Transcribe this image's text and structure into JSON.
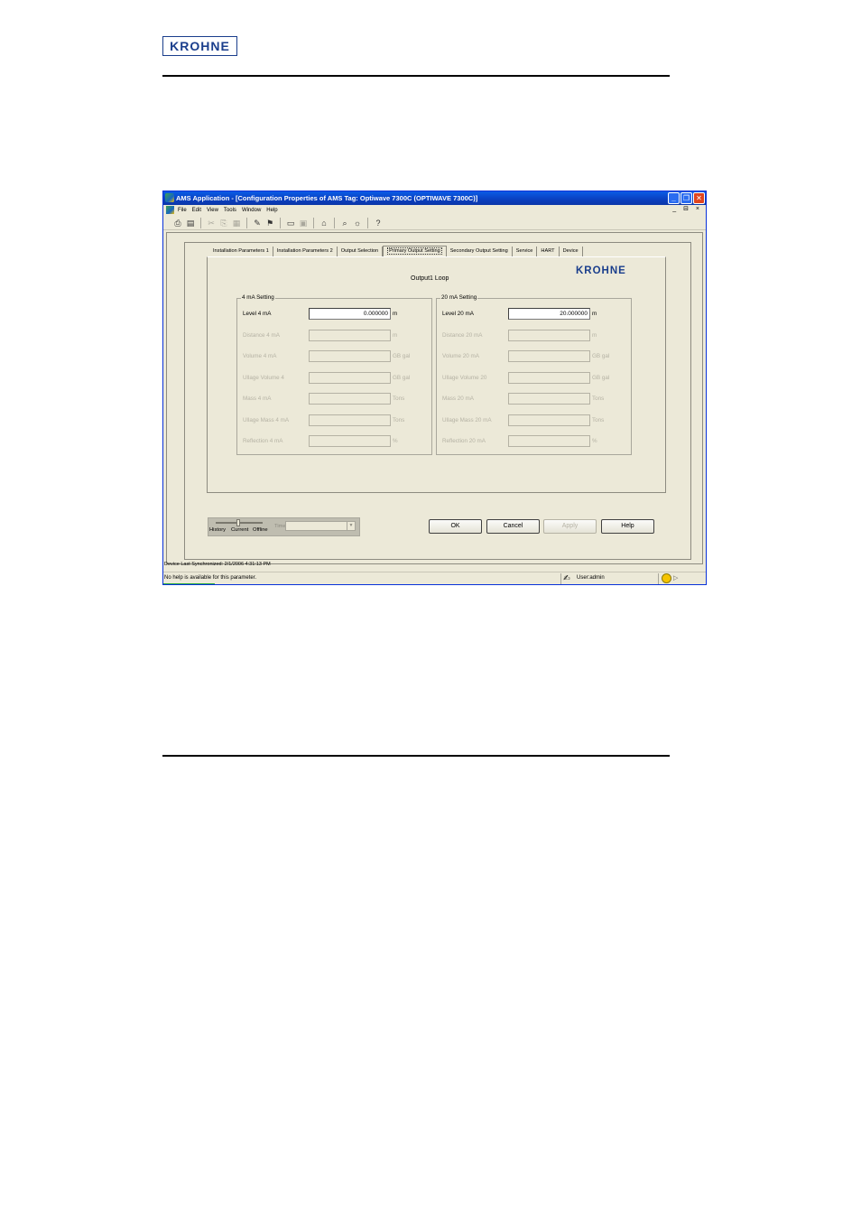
{
  "doc": {
    "logo": "KROHNE"
  },
  "window": {
    "title": "AMS Application - [Configuration Properties of AMS Tag: Optiwave 7300C (OPTIWAVE 7300C)]",
    "controls": {
      "minimize": "_",
      "restore": "❐",
      "close": "✕"
    }
  },
  "menubar": {
    "items": [
      "File",
      "Edit",
      "View",
      "Tools",
      "Window",
      "Help"
    ],
    "mdi_controls": "_ ⊟ ×"
  },
  "toolbar": {
    "icons": [
      "print-icon",
      "print-preview-icon",
      "cut-icon",
      "copy-icon",
      "paste-icon",
      "configure-icon",
      "device-icon",
      "window-icon",
      "window2-icon",
      "tree-icon",
      "find-icon",
      "alert-icon",
      "help-icon"
    ]
  },
  "tabs": [
    {
      "label": "Installation Parameters 1",
      "active": false
    },
    {
      "label": "Installation Parameters 2",
      "active": false
    },
    {
      "label": "Output Selection",
      "active": false
    },
    {
      "label": "Primary Output Setting",
      "active": true
    },
    {
      "label": "Secondary Output Setting",
      "active": false
    },
    {
      "label": "Service",
      "active": false
    },
    {
      "label": "HART",
      "active": false
    },
    {
      "label": "Device",
      "active": false
    }
  ],
  "panel": {
    "title": "Output1  Loop",
    "logo": "KROHNE"
  },
  "group_4ma": {
    "legend": "4 mA Setting",
    "rows": [
      {
        "label": "Level 4 mA",
        "value": "0.000000",
        "unit": "m",
        "enabled": true
      },
      {
        "label": "Distance 4 mA",
        "value": "",
        "unit": "m",
        "enabled": false
      },
      {
        "label": "Volume 4 mA",
        "value": "",
        "unit": "GB gal",
        "enabled": false
      },
      {
        "label": "Ullage Volume 4",
        "value": "",
        "unit": "GB gal",
        "enabled": false
      },
      {
        "label": "Mass 4 mA",
        "value": "",
        "unit": "Tons",
        "enabled": false
      },
      {
        "label": "Ullage Mass 4 mA",
        "value": "",
        "unit": "Tons",
        "enabled": false
      },
      {
        "label": "Reflection 4 mA",
        "value": "",
        "unit": "%",
        "enabled": false
      }
    ]
  },
  "group_20ma": {
    "legend": "20 mA Setting",
    "rows": [
      {
        "label": "Level 20 mA",
        "value": "20.000000",
        "unit": "m",
        "enabled": true
      },
      {
        "label": "Distance 20 mA",
        "value": "",
        "unit": "m",
        "enabled": false
      },
      {
        "label": "Volume 20 mA",
        "value": "",
        "unit": "GB gal",
        "enabled": false
      },
      {
        "label": "Ullage Volume 20",
        "value": "",
        "unit": "GB gal",
        "enabled": false
      },
      {
        "label": "Mass 20 mA",
        "value": "",
        "unit": "Tons",
        "enabled": false
      },
      {
        "label": "Ullage Mass 20 mA",
        "value": "",
        "unit": "Tons",
        "enabled": false
      },
      {
        "label": "Reflection 20 mA",
        "value": "",
        "unit": "%",
        "enabled": false
      }
    ]
  },
  "mode": {
    "history": "History",
    "current": "Current",
    "offline": "Offline",
    "time_label": "Time"
  },
  "buttons": {
    "ok": "OK",
    "cancel": "Cancel",
    "apply": "Apply",
    "help": "Help"
  },
  "status": {
    "sync": "Device Last Synchronized: 2/1/2006 4:31:13 PM",
    "message": "No help is available for this parameter.",
    "user": "User:admin"
  }
}
